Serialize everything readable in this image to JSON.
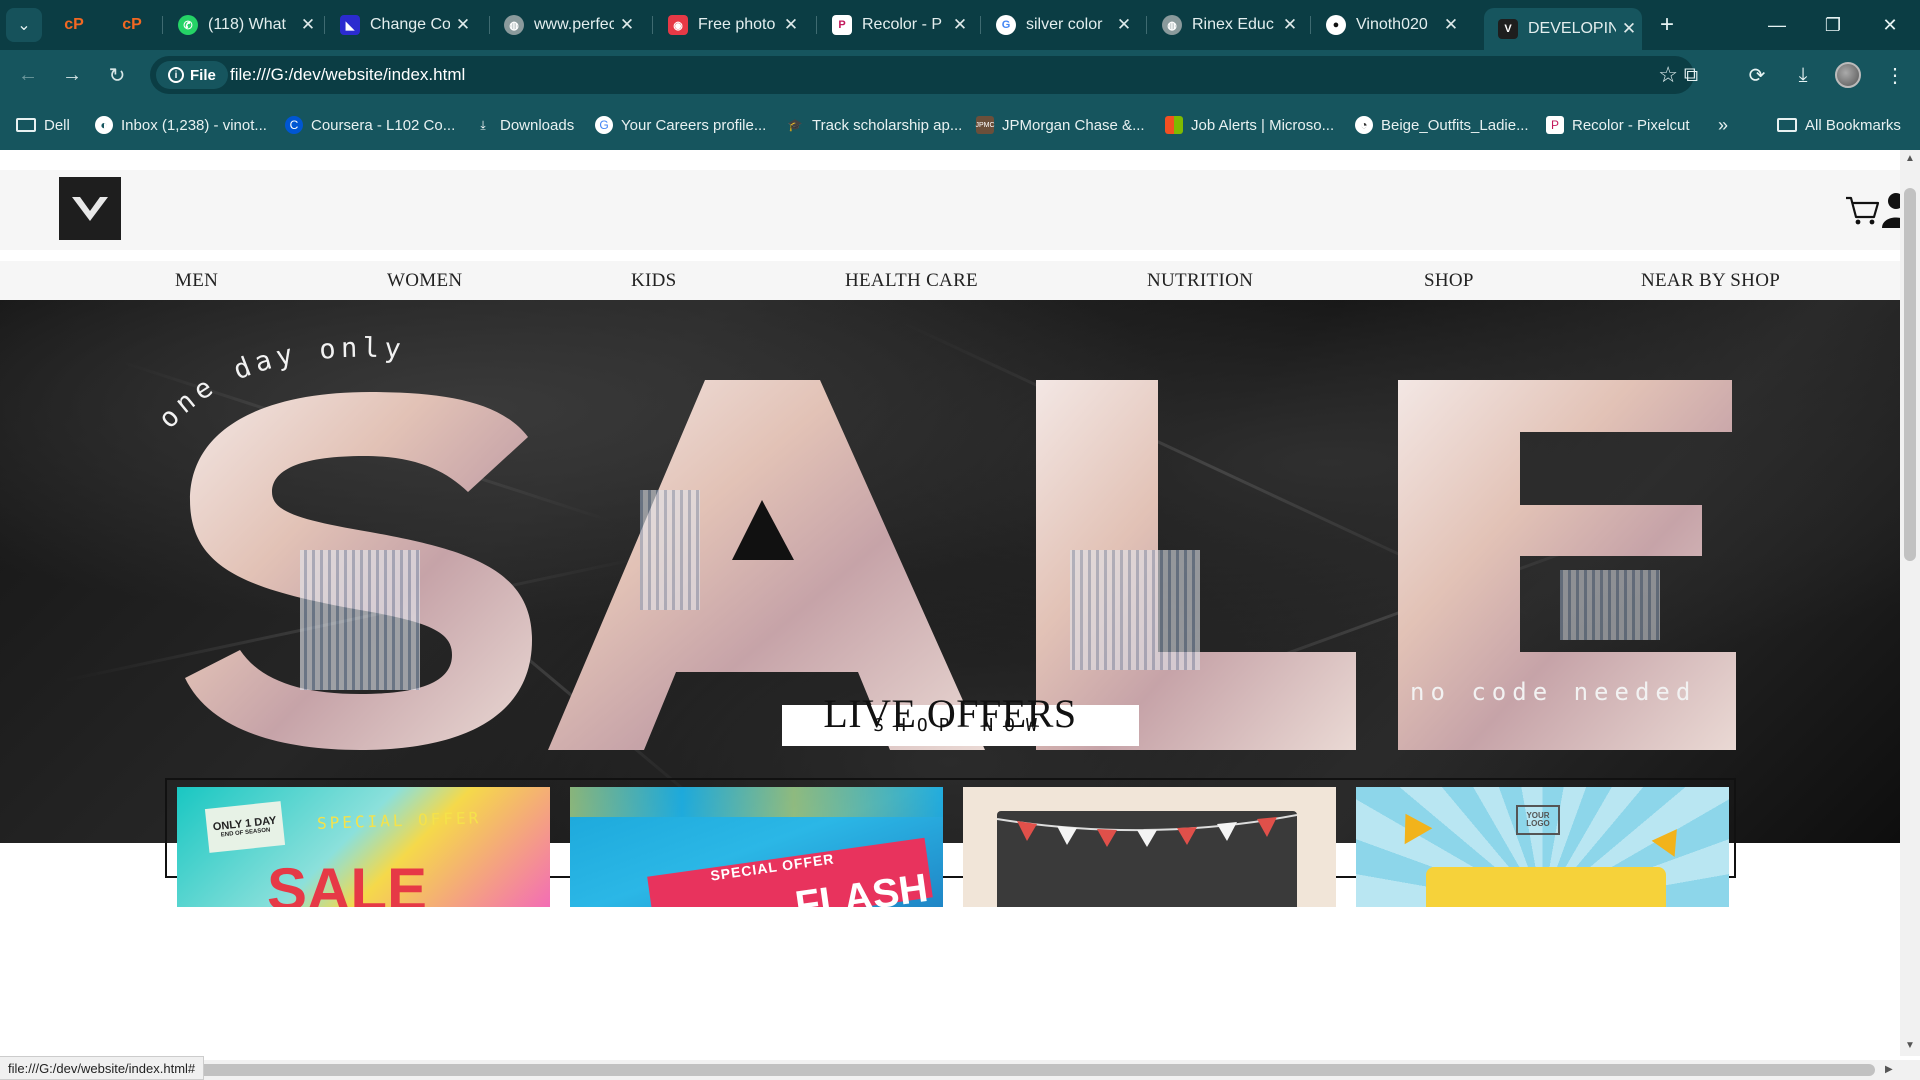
{
  "browser": {
    "tabs": [
      {
        "title": "",
        "favicon": "cpanel-icon",
        "color": "#f26822"
      },
      {
        "title": "",
        "favicon": "cpanel-icon",
        "color": "#f26822"
      },
      {
        "title": "(118) What",
        "favicon": "whatsapp-icon",
        "color": "#25d366"
      },
      {
        "title": "Change Co",
        "favicon": "app-icon",
        "color": "#2b2bcf"
      },
      {
        "title": "www.perfec",
        "favicon": "globe-icon",
        "color": "#8a9a9c"
      },
      {
        "title": "Free photo",
        "favicon": "photo-editor-icon",
        "color": "#e63946"
      },
      {
        "title": "Recolor - P",
        "favicon": "pixelcut-icon",
        "color": "#ffffff"
      },
      {
        "title": "silver color",
        "favicon": "google-icon",
        "color": "#ffffff"
      },
      {
        "title": "Rinex Educ",
        "favicon": "globe-icon",
        "color": "#8a9a9c"
      },
      {
        "title": "Vinoth020",
        "favicon": "github-icon",
        "color": "#ffffff"
      },
      {
        "title": "DEVELOPIN",
        "favicon": "site-logo-icon",
        "color": "#1e1e1e",
        "active": true
      }
    ],
    "url_chip": "File",
    "url": "file:///G:/dev/website/index.html",
    "bookmarks": [
      {
        "label": "Dell",
        "icon": "folder-icon"
      },
      {
        "label": "Inbox (1,238) - vinot...",
        "icon": "mail-icon"
      },
      {
        "label": "Coursera - L102 Co...",
        "icon": "coursera-icon"
      },
      {
        "label": "Downloads",
        "icon": "download-icon"
      },
      {
        "label": "Your Careers profile...",
        "icon": "google-icon"
      },
      {
        "label": "Track scholarship ap...",
        "icon": "scholarship-icon"
      },
      {
        "label": "JPMorgan Chase &...",
        "icon": "jpmorgan-icon"
      },
      {
        "label": "Job Alerts | Microso...",
        "icon": "microsoft-icon"
      },
      {
        "label": "Beige_Outfits_Ladie...",
        "icon": "chart-icon"
      },
      {
        "label": "Recolor - Pixelcut",
        "icon": "pixelcut-icon"
      }
    ],
    "all_bookmarks": "All Bookmarks",
    "status_url": "file:///G:/dev/website/index.html#"
  },
  "site": {
    "nav": [
      "MEN",
      "WOMEN",
      "KIDS",
      "HEALTH CARE",
      "NUTRITION",
      "SHOP",
      "NEAR BY SHOP"
    ],
    "hero": {
      "word": "SALE",
      "tagline_top": "one day only",
      "tagline_bottom": "no code needed",
      "cta": "SHOP NOW"
    },
    "offers_title": "LIVE OFFERS",
    "offer_cards": [
      {
        "badge": "ONLY 1 DAY",
        "sub": "END OF SEASON",
        "label": "SPECIAL OFFER",
        "big": "SALE"
      },
      {
        "label": "SPECIAL OFFER",
        "big": "FLASH"
      },
      {
        "label": ""
      },
      {
        "label": "YOUR LOGO"
      }
    ]
  }
}
